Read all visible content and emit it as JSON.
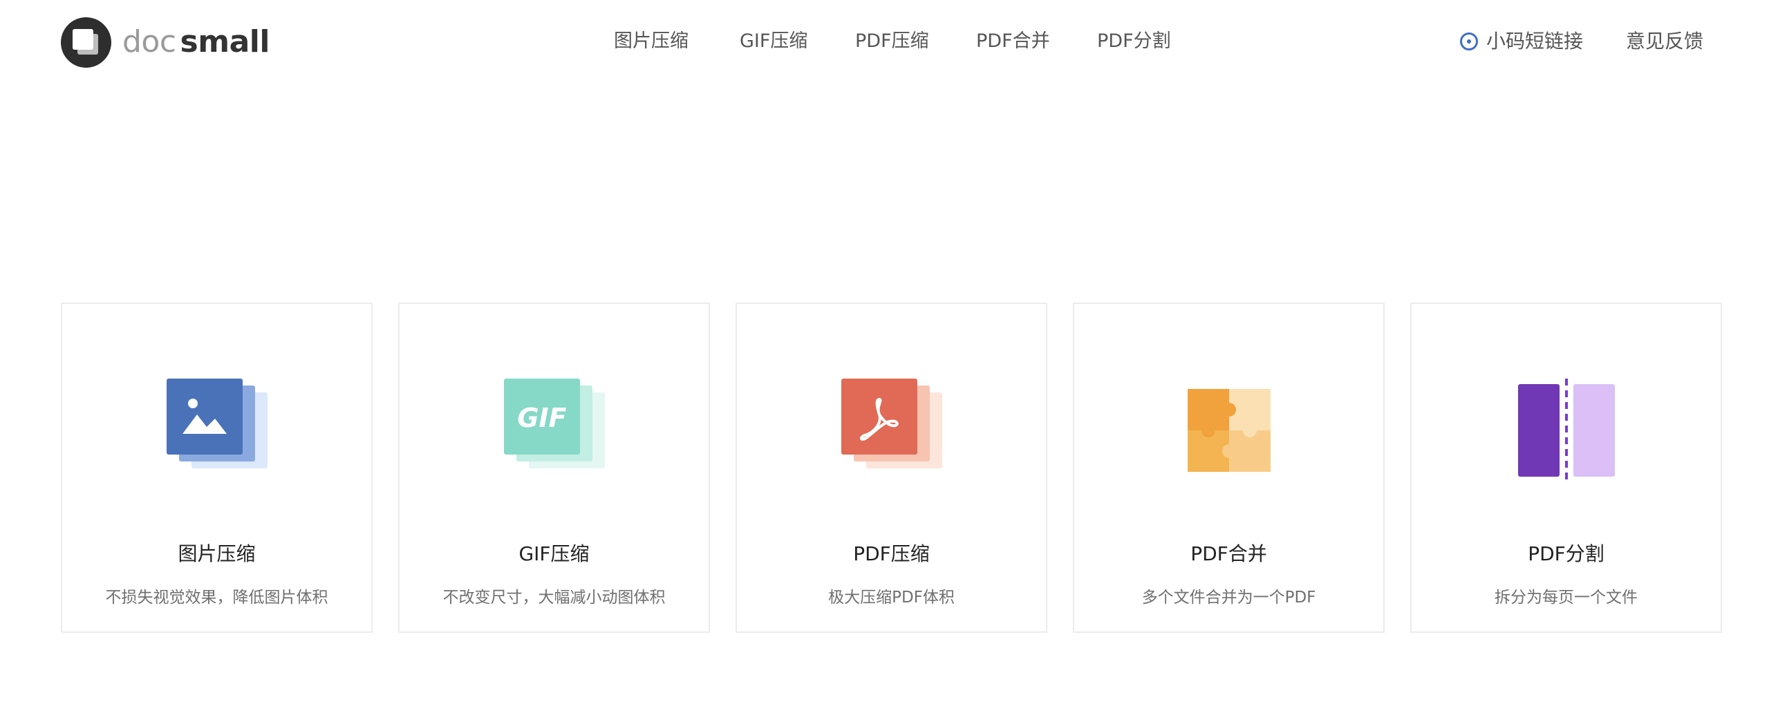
{
  "brand": {
    "part1": "doc",
    "part2": "small"
  },
  "nav": {
    "items": [
      {
        "label": "图片压缩"
      },
      {
        "label": "GIF压缩"
      },
      {
        "label": "PDF压缩"
      },
      {
        "label": "PDF合并"
      },
      {
        "label": "PDF分割"
      }
    ],
    "short_link": "小码短链接",
    "feedback": "意见反馈"
  },
  "cards": [
    {
      "title": "图片压缩",
      "desc": "不损失视觉效果，降低图片体积",
      "icon": "image-icon",
      "color": "#4a72b8"
    },
    {
      "title": "GIF压缩",
      "desc": "不改变尺寸，大幅减小动图体积",
      "icon": "gif-icon",
      "icon_text": "GIF",
      "color": "#86d8c7"
    },
    {
      "title": "PDF压缩",
      "desc": "极大压缩PDF体积",
      "icon": "pdf-icon",
      "color": "#e06a55"
    },
    {
      "title": "PDF合并",
      "desc": "多个文件合并为一个PDF",
      "icon": "puzzle-icon",
      "color": "#f1a23d"
    },
    {
      "title": "PDF分割",
      "desc": "拆分为每页一个文件",
      "icon": "split-icon",
      "color": "#7038b4"
    }
  ]
}
